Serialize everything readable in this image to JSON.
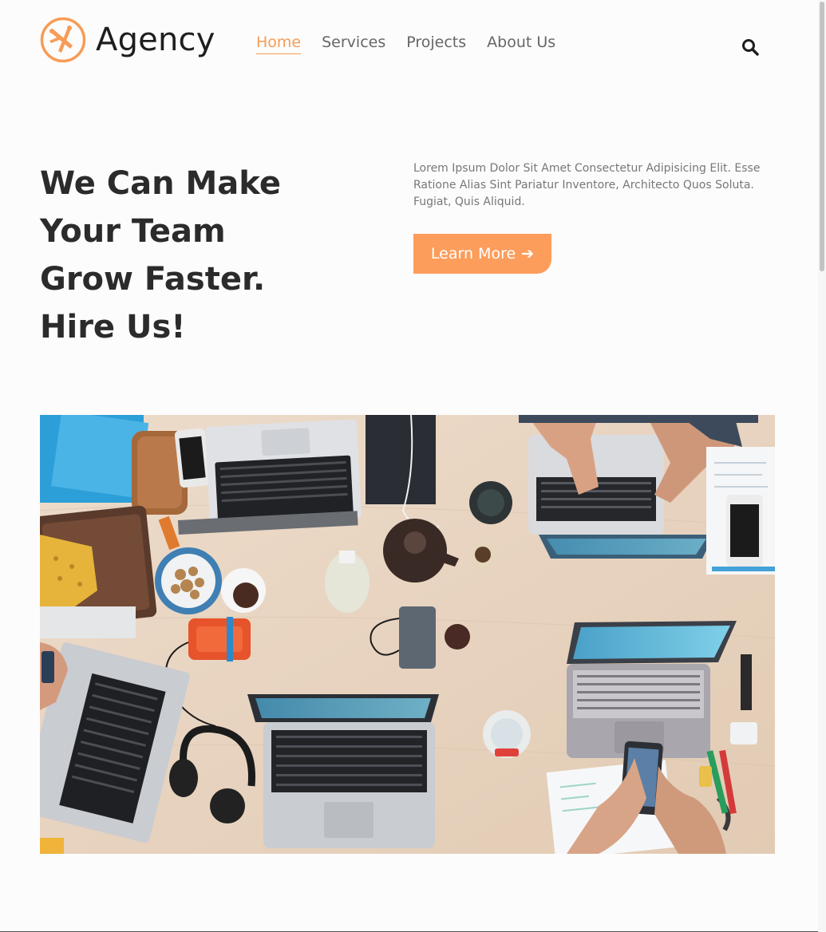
{
  "brand": {
    "name": "Agency",
    "logo_icon": "plane-logo-icon",
    "accent": "#f79c56"
  },
  "nav": {
    "items": [
      {
        "label": "Home",
        "active": true
      },
      {
        "label": "Services",
        "active": false
      },
      {
        "label": "Projects",
        "active": false
      },
      {
        "label": "About Us",
        "active": false
      }
    ],
    "search_icon": "search-icon"
  },
  "hero": {
    "title_lines": [
      "We Can Make",
      "Your Team",
      "Grow Faster.",
      "Hire Us!"
    ],
    "text": "Lorem Ipsum Dolor Sit Amet Consectetur Adipisicing Elit. Esse Ratione Alias Sint Pariatur Inventore, Architecto Quos Soluta. Fugiat, Quis Aliquid.",
    "cta_label": "Learn More",
    "cta_icon": "arrow-right-icon",
    "cta_color": "#fd9d5b"
  },
  "image": {
    "subject": "team-workspace-photo"
  }
}
